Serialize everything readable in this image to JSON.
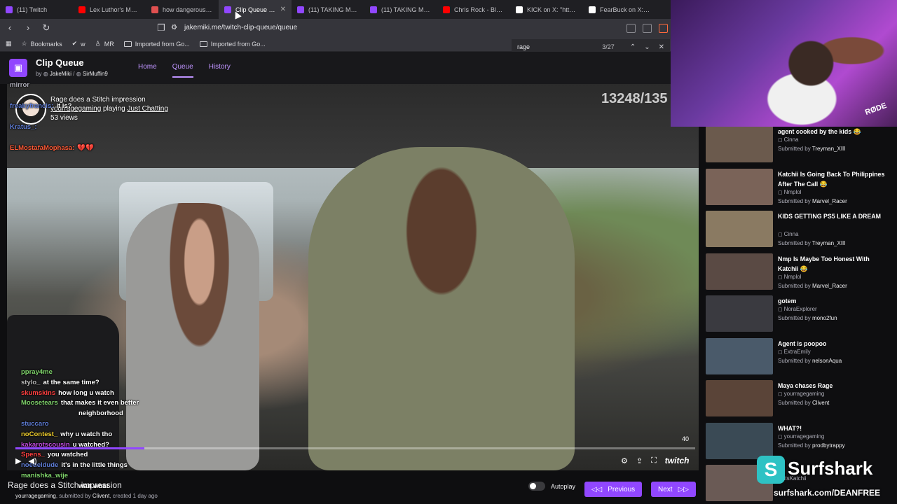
{
  "tabs": [
    {
      "title": "(11) Twitch",
      "color": "#9147ff"
    },
    {
      "title": "Lex Luthor's Monke",
      "color": "#ff0000"
    },
    {
      "title": "how dangerous is li",
      "color": "#e05050"
    },
    {
      "title": "Clip Queue - C",
      "color": "#9147ff",
      "active": true
    },
    {
      "title": "(11) TAKING MAYA",
      "color": "#9147ff"
    },
    {
      "title": "(11) TAKING MAYA",
      "color": "#9147ff"
    },
    {
      "title": "Chris Rock - Black P",
      "color": "#ff0000"
    },
    {
      "title": "KICK on X: \"https://",
      "color": "#ffffff"
    },
    {
      "title": "FearBuck on X: \"The",
      "color": "#ffffff"
    }
  ],
  "address": {
    "url": "jakemiki.me/twitch-clip-queue/queue"
  },
  "bookmarks": [
    {
      "label": "Bookmarks",
      "icon": "star-icon"
    },
    {
      "label": "w",
      "icon": "w-icon"
    },
    {
      "label": "MR",
      "icon": "mr-icon"
    },
    {
      "label": "Imported from Go...",
      "icon": "folder-icon"
    },
    {
      "label": "Imported from Go...",
      "icon": "folder-icon"
    }
  ],
  "find": {
    "query": "rage",
    "count": "3/27"
  },
  "app": {
    "title": "Clip Queue",
    "by": "by",
    "author1": "JakeMiki",
    "separator": "/",
    "author2": "SirMuffin9",
    "nav": [
      "Home",
      "Queue",
      "History"
    ]
  },
  "clip": {
    "title": "Rage does a Stitch impression",
    "channel": "yourragegaming",
    "playing": "playing",
    "game": "Just Chatting",
    "views": "53 views",
    "counter": "13248/135",
    "time": "40",
    "progress": 0.19
  },
  "chat_top": [
    {
      "name": "mirror",
      "msg": "",
      "color": "#adadb8"
    },
    {
      "name": "freakyfrancis:",
      "msg": "it is?",
      "color": "#5f7dd6"
    },
    {
      "name": "Kratus_:",
      "msg": "",
      "color": "#5f7dd6"
    },
    {
      "name": "ELMostafaMophasa:",
      "msg": "💔💔",
      "color": "#ff5a36"
    }
  ],
  "chat_bottom": [
    {
      "name": "ppray4me",
      "msg": "",
      "color": "#7fd36b"
    },
    {
      "name": "stylo_",
      "msg": "at the same time?",
      "color": "#bbbbbb"
    },
    {
      "name": "skumskins",
      "msg": "how long u watch",
      "color": "#ff4040"
    },
    {
      "name": "Moosetears",
      "msg": "that makes it even better",
      "color": "#7fd36b"
    },
    {
      "name": "",
      "msg": "neighborhood",
      "color": "#ffffff"
    },
    {
      "name": "stuccaro",
      "msg": "",
      "color": "#5f7dd6"
    },
    {
      "name": "noContest_",
      "msg": "why u watch tho",
      "color": "#f2d02e"
    },
    {
      "name": "kakarotscousin",
      "msg": "u watched?",
      "color": "#c04adc"
    },
    {
      "name": "Spens_",
      "msg": "you watched",
      "color": "#ff4040"
    },
    {
      "name": "noedeldude",
      "msg": "it's in the little things",
      "color": "#5f7dd6"
    },
    {
      "name": "manishka_wije",
      "msg": "",
      "color": "#7fd36b"
    },
    {
      "name": "",
      "msg": "wait what",
      "color": "#ffffff"
    }
  ],
  "below": {
    "title": "Rage does a Stitch impression",
    "channel": "yourragegaming",
    "submitted": ", submitted by",
    "submitter": "Clivent",
    "created": ", created 1 day ago",
    "autoplay": "Autoplay",
    "previous": "Previous",
    "next": "Next"
  },
  "queue": [
    {
      "title": "agent cooked by the kids 😂",
      "channel": "Cinna",
      "submitted": "Submitted by",
      "submitter": "Treyman_XIII",
      "thumb": "#6b5a4d"
    },
    {
      "title": "Katchii Is Going Back To Philippines After The Call 😂",
      "channel": "Nmplol",
      "submitted": "Submitted by",
      "submitter": "Marvel_Racer",
      "thumb": "#7a6358"
    },
    {
      "title": "KIDS GETTING PS5 LIKE A DREAM",
      "channel": "Cinna",
      "submitted": "Submitted by",
      "submitter": "Treyman_XIII",
      "thumb": "#8a7a62"
    },
    {
      "title": "Nmp Is Maybe Too Honest With Katchii 😂",
      "channel": "Nmplol",
      "submitted": "Submitted by",
      "submitter": "Marvel_Racer",
      "thumb": "#5a4a44"
    },
    {
      "title": "gotem",
      "channel": "NoraExplorer",
      "submitted": "Submitted by",
      "submitter": "mono2fun",
      "thumb": "#3a3a40"
    },
    {
      "title": "Agent is poopoo",
      "channel": "ExtraEmily",
      "submitted": "Submitted by",
      "submitter": "nelsonAqua",
      "thumb": "#4a5a6a"
    },
    {
      "title": "Maya chases Rage",
      "channel": "yourragegaming",
      "submitted": "Submitted by",
      "submitter": "Clivent",
      "thumb": "#5a4438"
    },
    {
      "title": "WHAT?!",
      "channel": "yourragegaming",
      "submitted": "Submitted by",
      "submitter": "prodbytrappy",
      "thumb": "#3a4a55"
    },
    {
      "title": "",
      "channel": "itsKatchii",
      "submitted": "",
      "submitter": "",
      "thumb": "#6a5a55"
    }
  ],
  "sponsor": {
    "name": "Surfshark",
    "url": "surfshark.com/DEANFREE",
    "rode": "RØDE"
  }
}
